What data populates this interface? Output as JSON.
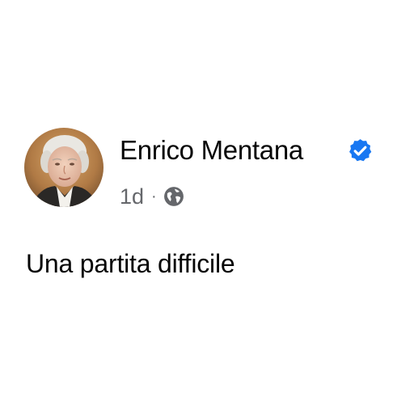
{
  "post": {
    "author": {
      "name": "Enrico Mentana",
      "verified": true,
      "avatar_icon": "profile-photo"
    },
    "meta": {
      "timestamp": "1d",
      "separator": "·",
      "audience_icon": "globe-icon"
    },
    "text": "Una partita difficile"
  },
  "colors": {
    "verified_badge": "#1877f2",
    "meta_text": "#65676b",
    "body_text": "#050505"
  }
}
